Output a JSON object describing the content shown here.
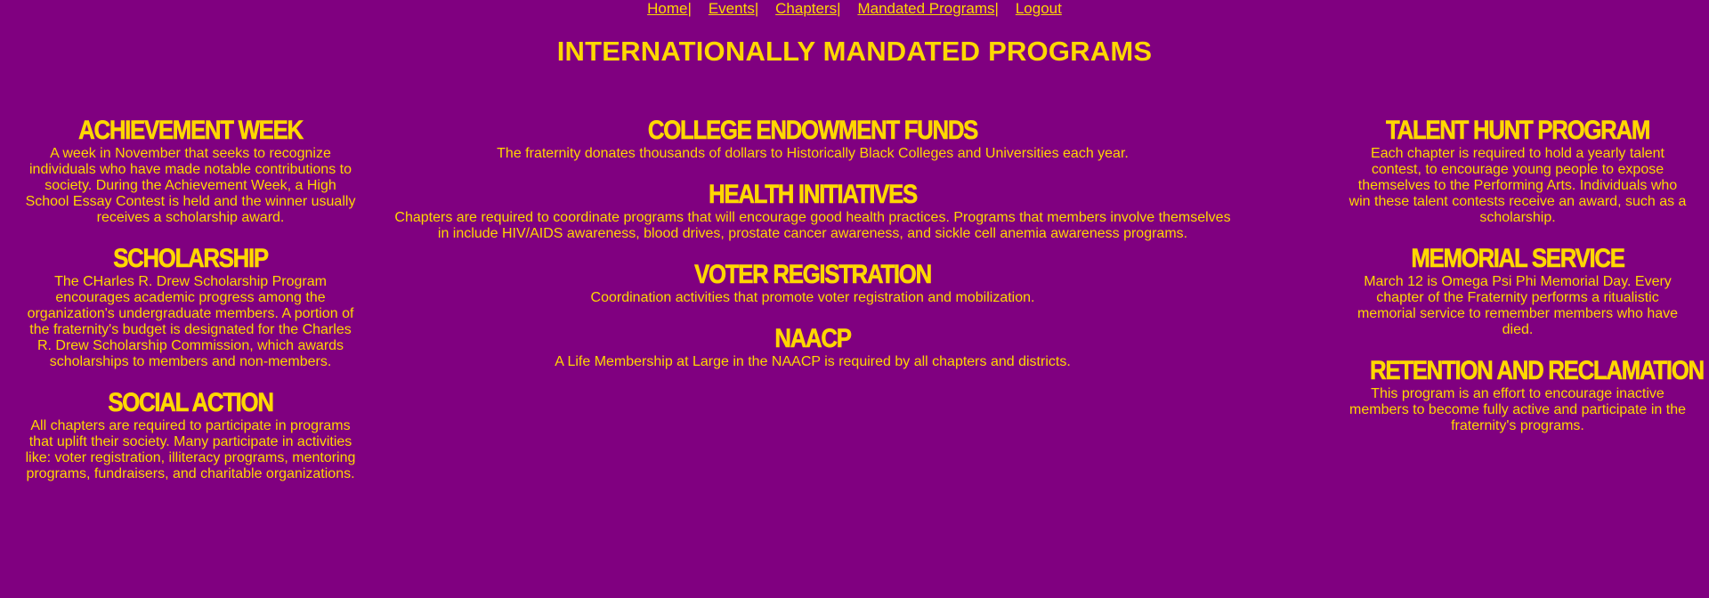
{
  "colors": {
    "background": "#800080",
    "text": "#FFD700"
  },
  "nav": {
    "items": [
      {
        "label": "Home"
      },
      {
        "label": "Events"
      },
      {
        "label": "Chapters"
      },
      {
        "label": "Mandated Programs"
      },
      {
        "label": "Logout"
      }
    ],
    "separator": "|"
  },
  "page_title": "INTERNATIONALLY MANDATED PROGRAMS",
  "left_column": [
    {
      "title": "ACHIEVEMENT WEEK",
      "description": "A week in November that seeks to recognize individuals who have made notable contributions to society. During the Achievement Week, a High School Essay Contest is held and the winner usually receives a scholarship award."
    },
    {
      "title": "SCHOLARSHIP",
      "description": "The CHarles R. Drew Scholarship Program encourages academic progress among the organization's undergraduate members. A portion of the fraternity's budget is designated for the Charles R. Drew Scholarship Commission, which awards scholarships to members and non-members."
    },
    {
      "title": "SOCIAL ACTION",
      "description": "All chapters are required to participate in programs that uplift their society. Many participate in activities like: voter registration, illiteracy programs, mentoring programs, fundraisers, and charitable organizations."
    }
  ],
  "middle_column": [
    {
      "title": "COLLEGE ENDOWMENT FUNDS",
      "description": "The fraternity donates thousands of dollars to Historically Black Colleges and Universities each year."
    },
    {
      "title": "HEALTH INITIATIVES",
      "description": "Chapters are required to coordinate programs that will encourage good health practices. Programs that members involve themselves in include HIV/AIDS awareness, blood drives, prostate cancer awareness, and sickle cell anemia awareness programs."
    },
    {
      "title": "VOTER REGISTRATION",
      "description": "Coordination activities that promote voter registration and mobilization."
    },
    {
      "title": "NAACP",
      "description": "A Life Membership at Large in the NAACP is required by all chapters and districts."
    }
  ],
  "right_column": [
    {
      "title": "TALENT HUNT PROGRAM",
      "description": "Each chapter is required to hold a yearly talent contest, to encourage young people to expose themselves to the Performing Arts. Individuals who win these talent contests receive an award, such as a scholarship."
    },
    {
      "title": "MEMORIAL SERVICE",
      "description": "March 12 is Omega Psi Phi Memorial Day. Every chapter of the Fraternity performs a ritualistic memorial service to remember members who have died."
    },
    {
      "title": "RETENTION AND RECLAMATION",
      "description": "This program is an effort to encourage inactive members to become fully active and participate in the fraternity's programs."
    }
  ]
}
